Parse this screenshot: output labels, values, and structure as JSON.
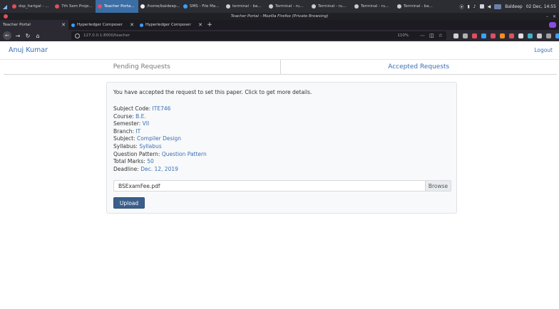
{
  "taskbar": {
    "tasks": [
      {
        "label": "dsp_harigal - ...",
        "color": "#e04f5f"
      },
      {
        "label": "7th Sem Proje...",
        "color": "#e04f5f"
      },
      {
        "label": "Teacher Porta...",
        "color": "#e04f5f"
      },
      {
        "label": "/home/baldeep...",
        "color": "#f0f0f0"
      },
      {
        "label": "SMS - File Ma...",
        "color": "#3aa0ff"
      },
      {
        "label": "terminal - ba...",
        "color": "#cccccc"
      },
      {
        "label": "Terminal - ru...",
        "color": "#cccccc"
      },
      {
        "label": "Terminal - ru...",
        "color": "#cccccc"
      },
      {
        "label": "Terminal - ru...",
        "color": "#cccccc"
      },
      {
        "label": "Terminal - ba...",
        "color": "#cccccc"
      }
    ],
    "active_index": 2,
    "user": "Baldeep",
    "clock": "02 Dec, 14:55"
  },
  "window": {
    "title": "Teacher Portal - Mozilla Firefox (Private Browsing)"
  },
  "browser": {
    "tabs": [
      {
        "label": "Teacher Portal",
        "active": true
      },
      {
        "label": "Hyperledger Composer",
        "active": false
      },
      {
        "label": "Hyperledger Composer",
        "active": false
      }
    ],
    "url": "127.0.0.1:8000/teacher",
    "zoom": "110%"
  },
  "page": {
    "brand": "Anuj Kumar",
    "logout": "Logout",
    "tabs": {
      "pending": "Pending Requests",
      "accepted": "Accepted Requests"
    },
    "notice": "You have accepted the request to set this paper. Click to get more details.",
    "fields": {
      "subject_code": {
        "label": "Subject Code:",
        "value": "ITE746"
      },
      "course": {
        "label": "Course:",
        "value": "B.E."
      },
      "semester": {
        "label": "Semester:",
        "value": "VII"
      },
      "branch": {
        "label": "Branch:",
        "value": "IT"
      },
      "subject": {
        "label": "Subject:",
        "value": "Compiler Design"
      },
      "syllabus": {
        "label": "Syllabus:",
        "value": "Syllabus"
      },
      "question_pattern": {
        "label": "Question Pattern:",
        "value": "Question Pattern"
      },
      "total_marks": {
        "label": "Total Marks:",
        "value": "50"
      },
      "deadline": {
        "label": "Deadline:",
        "value": "Dec. 12, 2019"
      }
    },
    "file": {
      "name": "BSExamFee.pdf",
      "browse_label": "Browse"
    },
    "upload_label": "Upload"
  }
}
